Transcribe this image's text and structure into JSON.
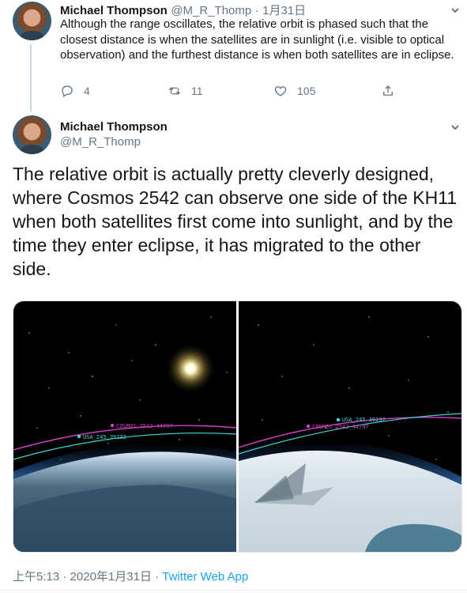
{
  "tweet1": {
    "author_name": "Michael Thompson",
    "handle": "@M_R_Thomp",
    "dot": "·",
    "date": "1月31日",
    "text": "Although the range oscillates, the relative orbit is phased such that the closest distance is when the satellites are in sunlight (i.e. visible to optical observation) and the furthest distance is when both satellites are in eclipse.",
    "replies": "4",
    "retweets": "11",
    "likes": "105"
  },
  "tweet2": {
    "author_name": "Michael Thompson",
    "handle": "@M_R_Thomp",
    "text": "The relative orbit is actually pretty cleverly designed, where Cosmos 2542 can observe one side of the KH11 when both satellites first come into sunlight, and by the time they enter eclipse, it has migrated to the other side.",
    "images": [
      {
        "label_cosmos": "COSMOS_2542_44797",
        "label_usa": "USA_245_39232"
      },
      {
        "label_cosmos": "COSMOS_2542_44797",
        "label_usa": "USA_245_39232"
      }
    ]
  },
  "footer": {
    "time": "上午5:13",
    "sep1": "·",
    "date": "2020年1月31日",
    "sep2": "·",
    "app": "Twitter Web App"
  },
  "colors": {
    "link": "#1da1f2",
    "muted": "#657786",
    "cosmos_orbit": "#d63cc8",
    "usa_orbit": "#3fd6d6"
  },
  "icons": [
    "reply-icon",
    "retweet-icon",
    "like-icon",
    "share-icon",
    "chevron-down-icon"
  ]
}
